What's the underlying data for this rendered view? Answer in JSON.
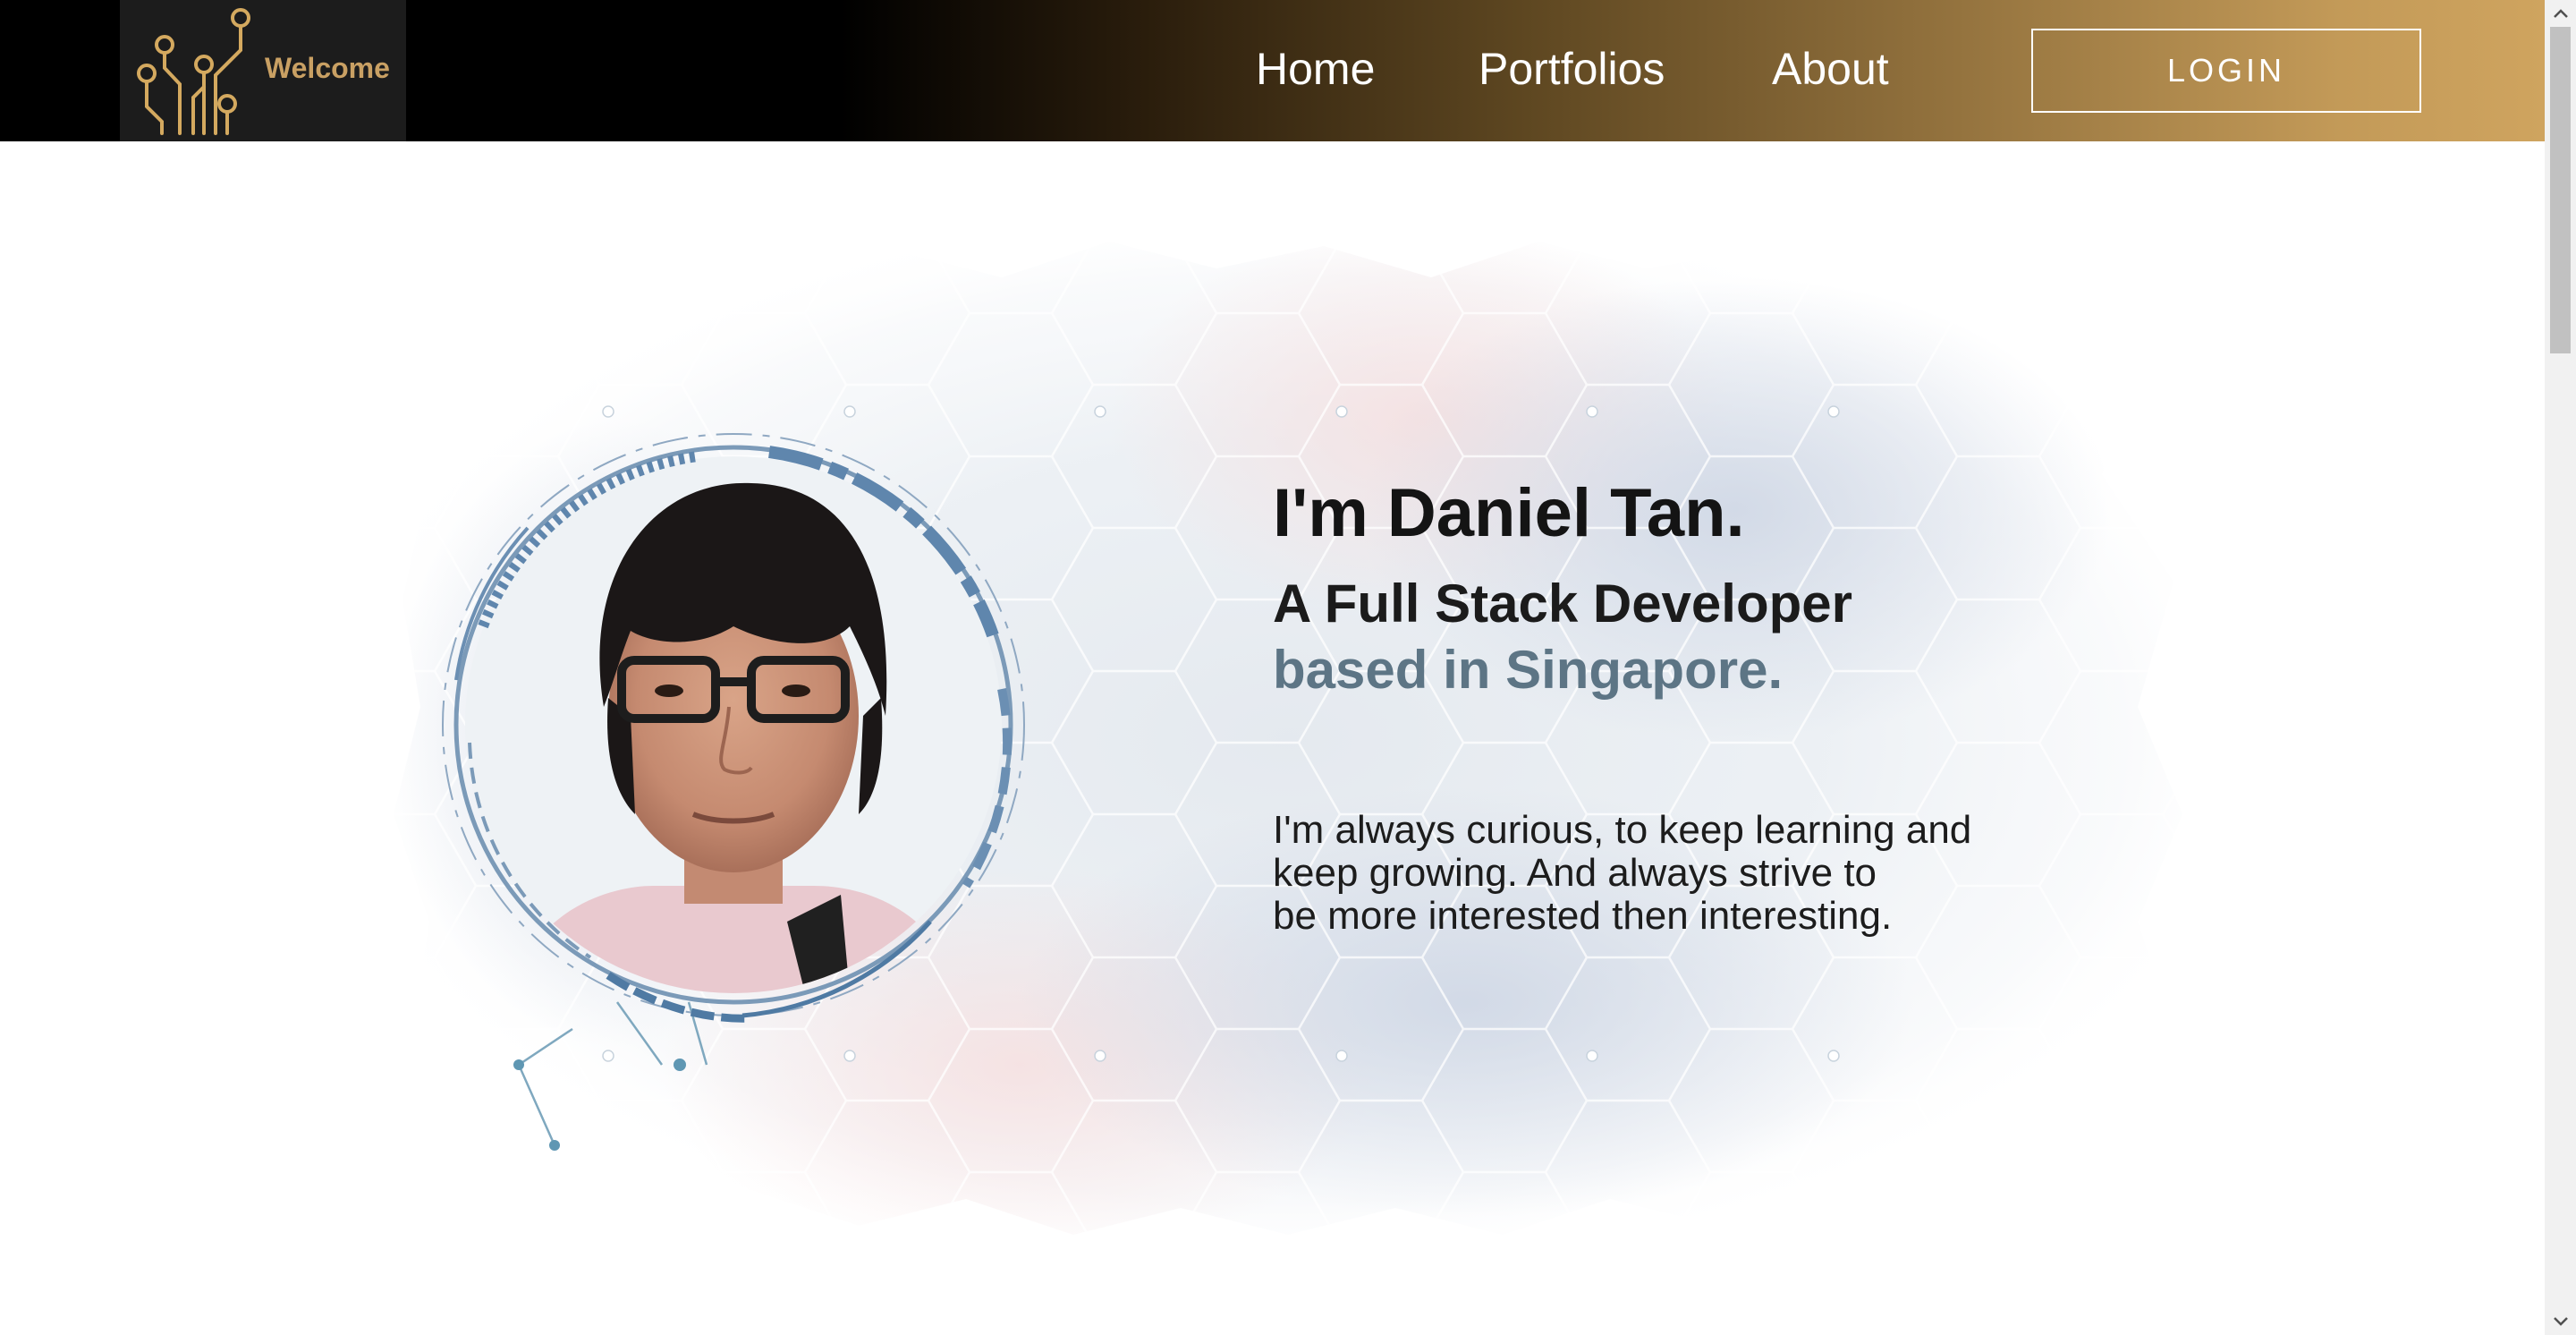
{
  "nav": {
    "brand_text": "Welcome",
    "items": [
      {
        "label": "Home"
      },
      {
        "label": "Portfolios"
      },
      {
        "label": "About"
      }
    ],
    "login_label": "LOGIN"
  },
  "hero": {
    "title": "I'm Daniel Tan.",
    "subtitle_line1": "A Full Stack Developer",
    "subtitle_line2": "based in Singapore.",
    "body_lines": [
      "I'm always curious, to keep learning and",
      "keep growing. And always strive to",
      "be more interested then interesting."
    ]
  },
  "colors": {
    "brand_gold": "#c9a063",
    "nav_gradient_end": "#cfa45f",
    "accent_blue": "#5d7585"
  },
  "icons": {
    "logo": "circuit-tree-logo",
    "scroll_up": "chevron-up-icon",
    "scroll_down": "chevron-down-icon"
  }
}
